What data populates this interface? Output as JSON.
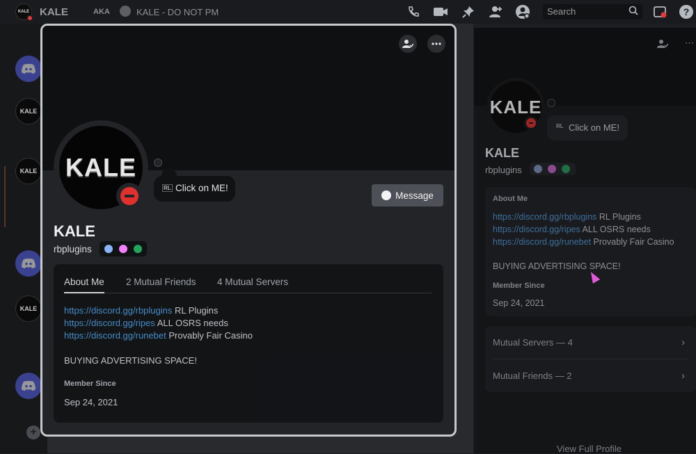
{
  "topbar": {
    "title": "KALE",
    "aka_label": "AKA",
    "aka_name": "KALE - DO NOT PM",
    "search_placeholder": "Search",
    "icons": [
      "phone-icon",
      "video-icon",
      "pin-icon",
      "add-friend-icon",
      "user-profile-icon",
      "inbox-icon",
      "help-icon"
    ]
  },
  "rail": {
    "servers": [
      "discord-logo",
      "KALE",
      "KALE",
      "discord-logo",
      "KALE",
      "discord-logo"
    ]
  },
  "profile_modal": {
    "avatar_text": "KALE",
    "custom_status": "Click on ME!",
    "custom_status_icon": "RL",
    "message_button": "Message",
    "display_name": "KALE",
    "username": "rbplugins",
    "tabs": [
      "About Me",
      "2 Mutual Friends",
      "4 Mutual Servers"
    ],
    "about": [
      {
        "link": "https://discord.gg/rbplugins",
        "text": " RL Plugins"
      },
      {
        "link": "https://discord.gg/ripes",
        "text": " ALL OSRS needs"
      },
      {
        "link": "https://discord.gg/runebet",
        "text": " Provably Fair Casino"
      }
    ],
    "about_extra": "BUYING ADVERTISING SPACE!",
    "member_since_label": "Member Since",
    "member_since": "Sep 24, 2021"
  },
  "side_panel": {
    "avatar_text": "KALE",
    "custom_status": "Click on ME!",
    "custom_status_icon": "RL",
    "display_name": "KALE",
    "username": "rbplugins",
    "about_label": "About Me",
    "about": [
      {
        "link": "https://discord.gg/rbplugins",
        "text": " RL Plugins"
      },
      {
        "link": "https://discord.gg/ripes",
        "text": " ALL OSRS needs"
      },
      {
        "link": "https://discord.gg/runebet",
        "text": " Provably Fair Casino"
      }
    ],
    "about_extra": "BUYING ADVERTISING SPACE!",
    "member_since_label": "Member Since",
    "member_since": "Sep 24, 2021",
    "mutual_servers": "Mutual Servers — 4",
    "mutual_friends": "Mutual Friends — 2",
    "view_full_profile": "View Full Profile"
  },
  "colors": {
    "link": "#4a9fe4",
    "dnd_status": "#e0312f",
    "badge_1": "#8ab4f8",
    "badge_2": "#f47fff",
    "badge_3": "#23a55a"
  }
}
